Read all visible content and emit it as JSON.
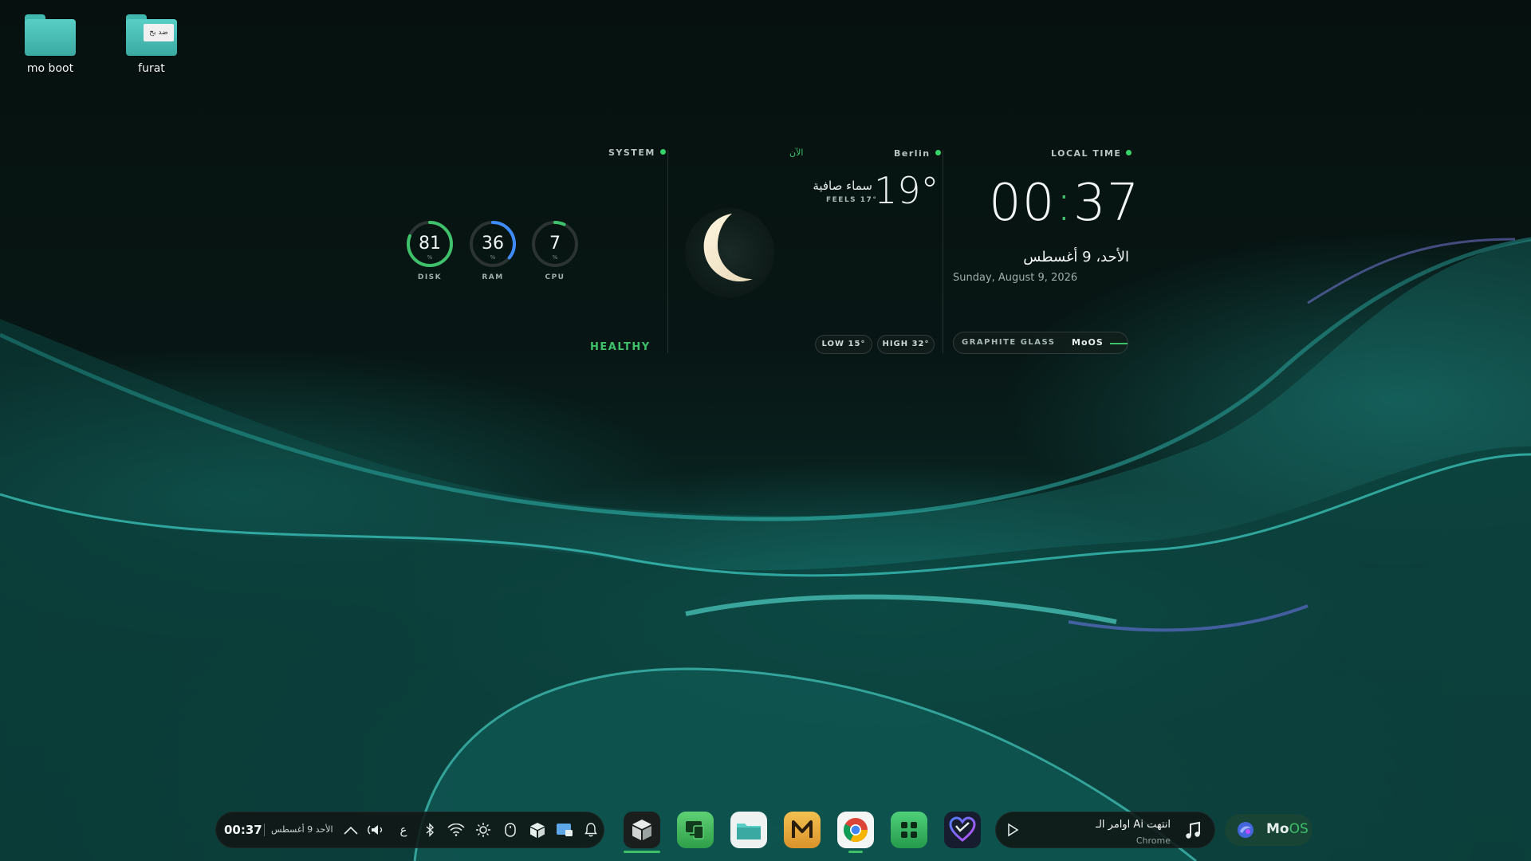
{
  "desktop": {
    "icons": [
      {
        "label": "mo boot",
        "icon": "folder-icon"
      },
      {
        "label": "furat",
        "icon": "folder-icon",
        "preview_text": "ضد بخ"
      }
    ]
  },
  "widgets": {
    "system": {
      "label": "SYSTEM",
      "status": "HEALTHY",
      "gauges": [
        {
          "name": "DISK",
          "value": "81",
          "unit": "%",
          "level": 0.81,
          "color": "#3fc06a"
        },
        {
          "name": "RAM",
          "value": "36",
          "unit": "%",
          "level": 0.36,
          "color": "#3f8cff"
        },
        {
          "name": "CPU",
          "value": "7",
          "unit": "%",
          "level": 0.07,
          "color": "#3fc06a"
        }
      ]
    },
    "weather": {
      "now_label": "الآن",
      "city": "Berlin",
      "temperature": "19°",
      "condition": "سماء صافية",
      "feels": "FEELS 17°",
      "low": "LOW 15°",
      "high": "HIGH 32°",
      "icon": "moon-icon"
    },
    "clock": {
      "label": "LOCAL TIME",
      "hours": "00",
      "minutes": "37",
      "date_ar": "الأحد، 9 أغسطس",
      "date_en": "Sunday, August 9, 2026",
      "theme_label": "GRAPHITE GLASS",
      "brand": "MoOS"
    }
  },
  "taskbar": {
    "time": "00:37",
    "date": "الأحد 9 أغسطس",
    "tray_icons": [
      "chevron-up-icon",
      "volume-icon",
      "keyboard-layout-icon",
      "bluetooth-icon",
      "wifi-icon",
      "brightness-icon",
      "mouse-icon",
      "box-icon",
      "screen-icon",
      "bell-icon"
    ],
    "keyboard_layout": "ع",
    "apps": [
      "mo-box-app-icon",
      "device-mirror-app-icon",
      "files-app-icon",
      "m-app-icon",
      "chrome-app-icon",
      "grid-app-icon",
      "heart-app-icon"
    ],
    "media": {
      "title": "اوامر الـ Ai انتهت",
      "subtitle": "Chrome"
    },
    "start_brand_mo": "Mo",
    "start_brand_os": "OS"
  },
  "colors": {
    "accent": "#3fc06a",
    "ram": "#3f8cff",
    "teal": "#3fb8b0"
  }
}
